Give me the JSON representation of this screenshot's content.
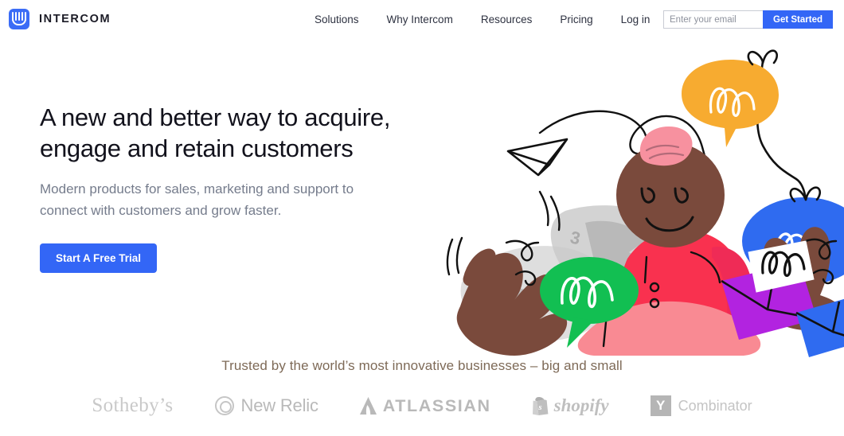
{
  "header": {
    "brand_name": "INTERCOM",
    "logo_icon": "intercom-logo-icon",
    "nav": [
      {
        "label": "Solutions"
      },
      {
        "label": "Why Intercom"
      },
      {
        "label": "Resources"
      },
      {
        "label": "Pricing"
      },
      {
        "label": "Log in"
      }
    ],
    "signup": {
      "email_placeholder": "Enter your email",
      "email_value": "",
      "button_label": "Get Started"
    }
  },
  "hero": {
    "headline_line1": "A new and better way to acquire,",
    "headline_line2": "engage and retain customers",
    "subhead_line1": "Modern products for sales, marketing and support to",
    "subhead_line2": "connect with customers and grow faster.",
    "cta_label": "Start A Free Trial",
    "illustration_name": "people-with-chat-bubbles-and-envelopes-illustration"
  },
  "trust": {
    "tagline": "Trusted by the world’s most innovative businesses – big and small",
    "logos": [
      {
        "name": "sothebys",
        "label": "Sotheby’s"
      },
      {
        "name": "new-relic",
        "label": "New Relic"
      },
      {
        "name": "atlassian",
        "label": "ATLASSIAN"
      },
      {
        "name": "shopify",
        "label": "shopify"
      },
      {
        "name": "y-combinator",
        "label": "Combinator",
        "mark": "Y"
      }
    ]
  },
  "colors": {
    "brand_blue": "#3366f6",
    "headline": "#12121c",
    "subhead": "#757c8c",
    "trust_text": "#7e6a57",
    "logo_gray": "#c4c4c4",
    "illustration_orange": "#f7ab30",
    "illustration_blue": "#2f6bf0",
    "illustration_green": "#12bf52",
    "illustration_red": "#f9314f",
    "illustration_pink": "#f98a93",
    "illustration_purple": "#b223e0",
    "illustration_skin": "#7a4a3c",
    "illustration_hair_pink": "#f7919f"
  }
}
